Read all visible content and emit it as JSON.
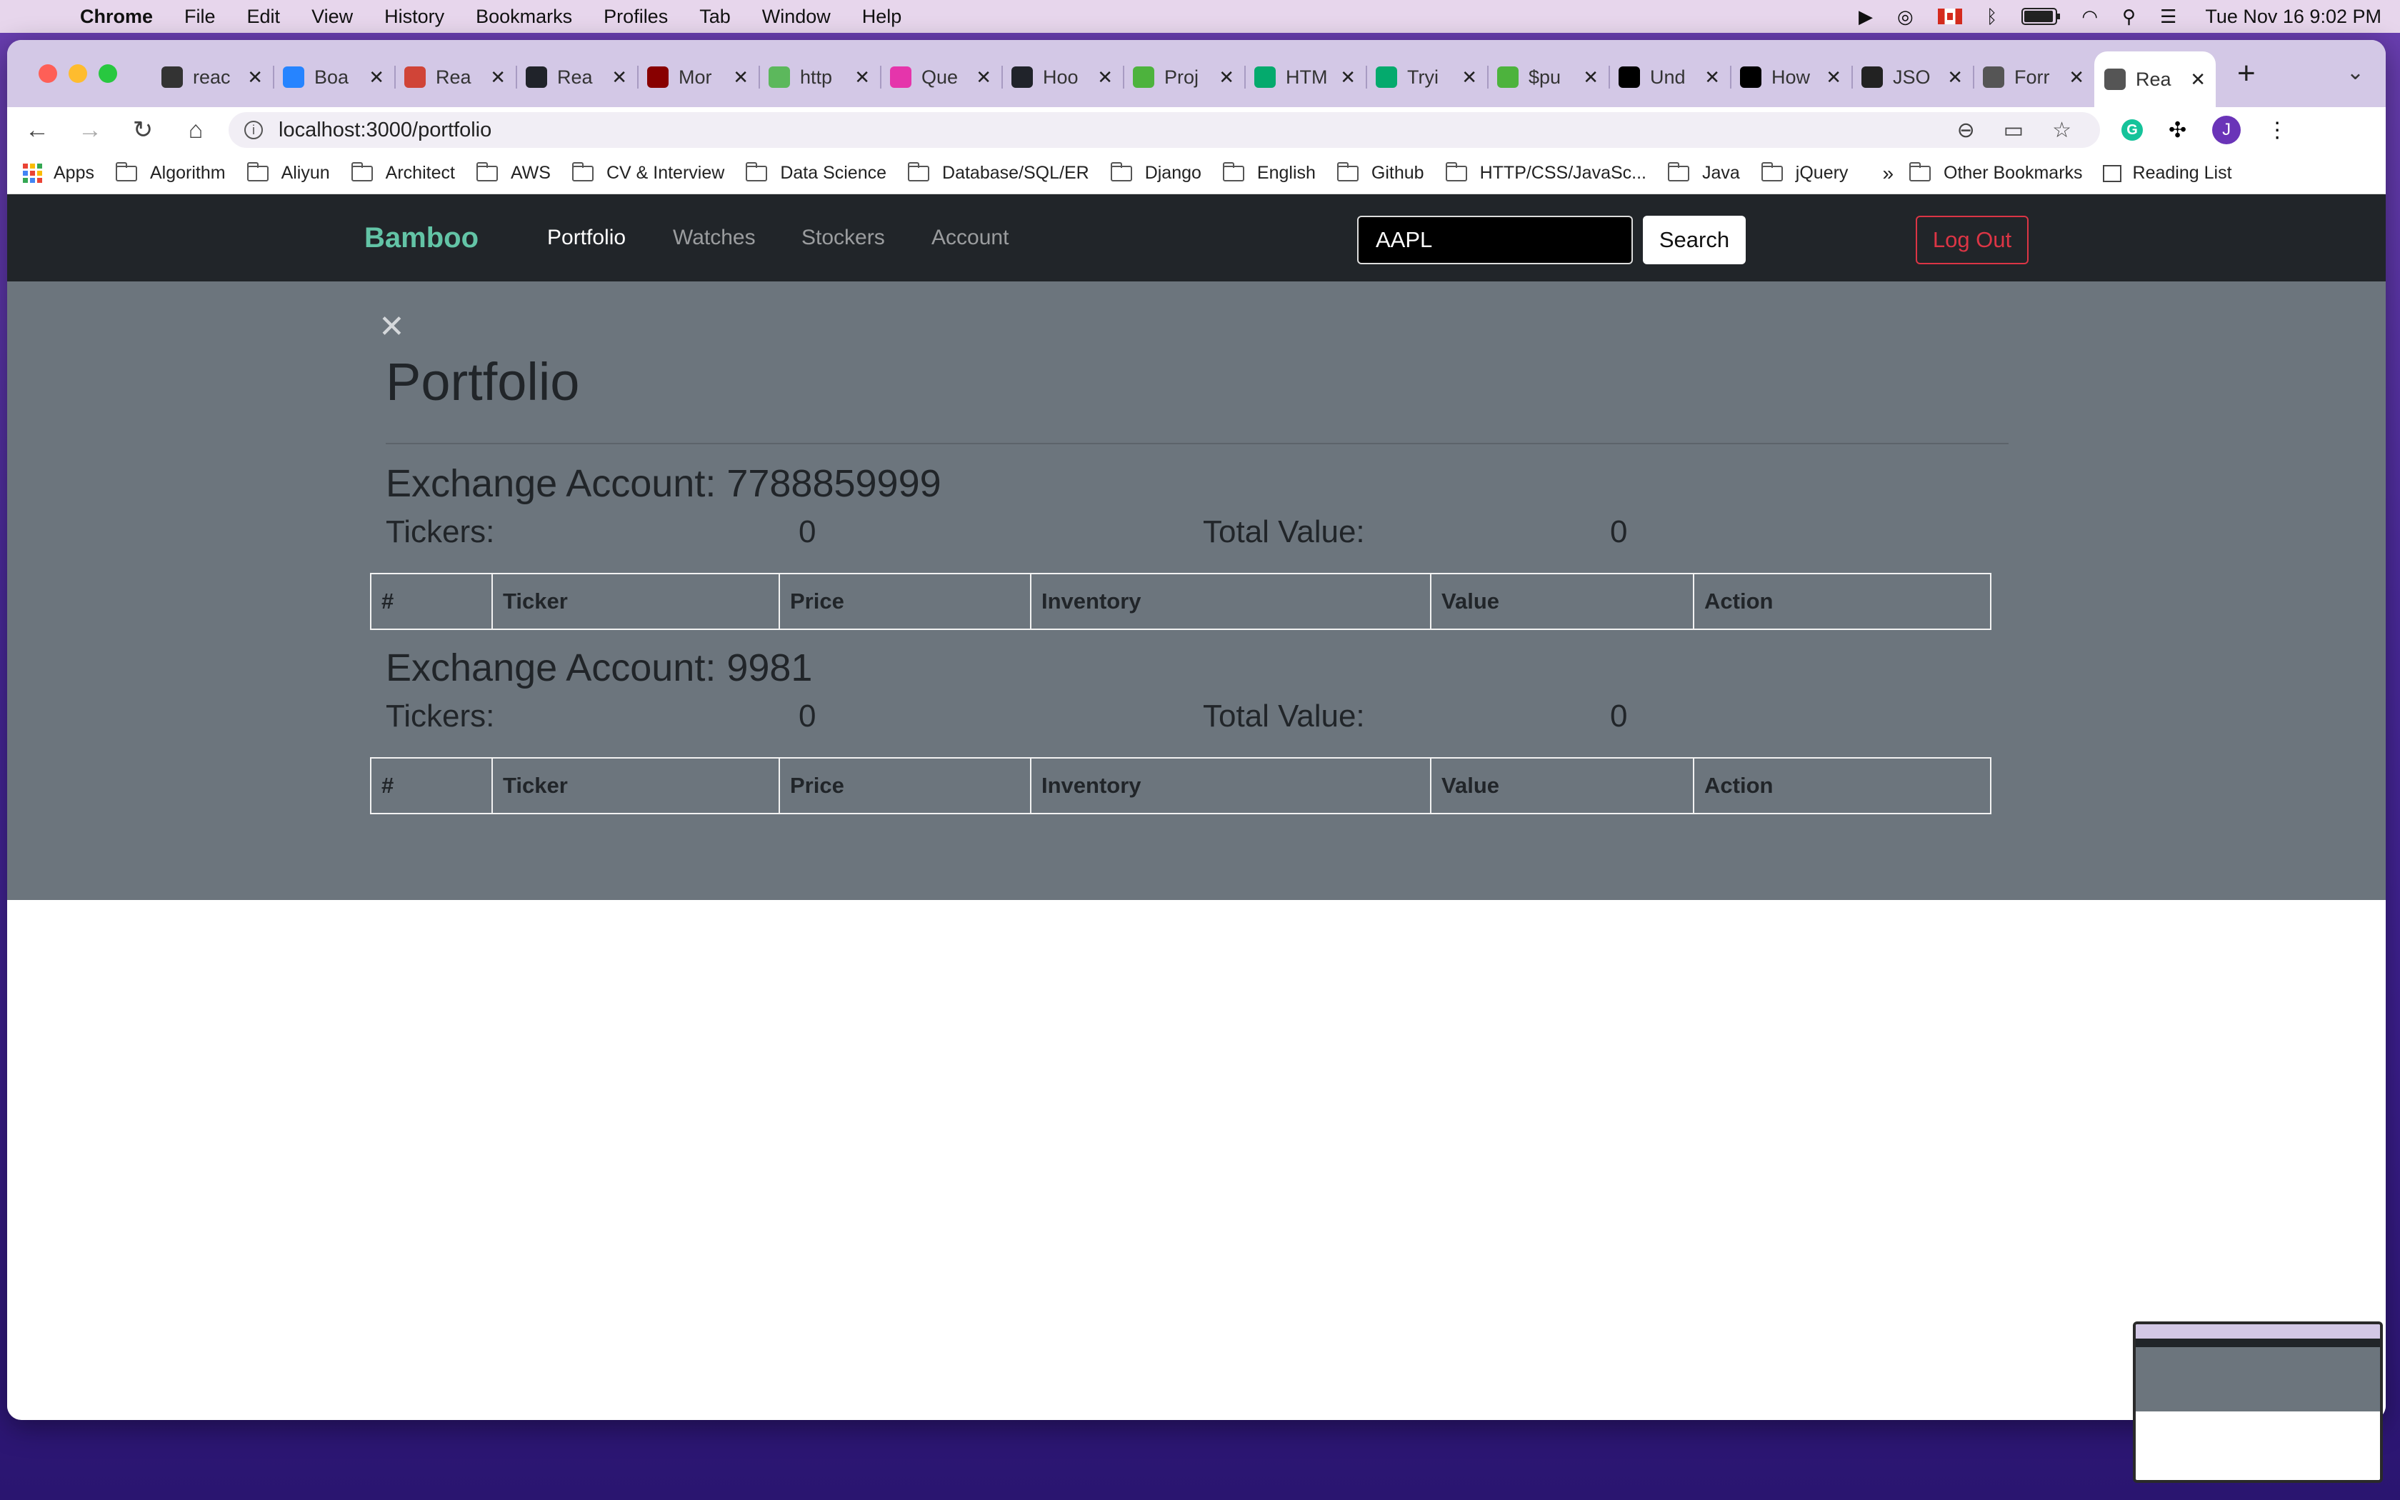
{
  "menubar": {
    "app_name": "Chrome",
    "items": [
      "File",
      "Edit",
      "View",
      "History",
      "Bookmarks",
      "Profiles",
      "Tab",
      "Window",
      "Help"
    ],
    "clock": "Tue Nov 16  9:02 PM"
  },
  "browser": {
    "tabs": [
      {
        "label": "reac",
        "icon": "github-icon",
        "color": "#333333"
      },
      {
        "label": "Boa",
        "icon": "jira-icon",
        "color": "#2684ff"
      },
      {
        "label": "Rea",
        "icon": "trello-icon",
        "color": "#d04437"
      },
      {
        "label": "Rea",
        "icon": "react-icon",
        "color": "#20232a"
      },
      {
        "label": "Mor",
        "icon": "mongoose-icon",
        "color": "#880000"
      },
      {
        "label": "http",
        "icon": "heart-icon",
        "color": "#5cb85c"
      },
      {
        "label": "Que",
        "icon": "graphql-icon",
        "color": "#e535ab"
      },
      {
        "label": "Hoo",
        "icon": "react-icon",
        "color": "#20232a"
      },
      {
        "label": "Proj",
        "icon": "leaf-icon",
        "color": "#4db33d"
      },
      {
        "label": "HTM",
        "icon": "w3-icon",
        "color": "#04aa6d"
      },
      {
        "label": "Tryi",
        "icon": "w3-icon",
        "color": "#04aa6d"
      },
      {
        "label": "$pu",
        "icon": "leaf-icon",
        "color": "#4db33d"
      },
      {
        "label": "Und",
        "icon": "medium-icon",
        "color": "#000000"
      },
      {
        "label": "How",
        "icon": "medium-icon",
        "color": "#000000"
      },
      {
        "label": "JSO",
        "icon": "json-icon",
        "color": "#222222"
      },
      {
        "label": "Forr",
        "icon": "globe-icon",
        "color": "#555555"
      },
      {
        "label": "Rea",
        "icon": "globe-icon",
        "color": "#555555",
        "active": true
      }
    ],
    "url": "localhost:3000/portfolio",
    "avatar_letter": "J",
    "ext_letter": "G",
    "bookmarks": [
      "Algorithm",
      "Aliyun",
      "Architect",
      "AWS",
      "CV & Interview",
      "Data Science",
      "Database/SQL/ER",
      "Django",
      "English",
      "Github",
      "HTTP/CSS/JavaSc...",
      "Java",
      "jQuery"
    ],
    "apps_label": "Apps",
    "more_label": "»",
    "other_bookmarks": "Other Bookmarks",
    "reading_list": "Reading List"
  },
  "app": {
    "brand": "Bamboo",
    "nav": [
      "Portfolio",
      "Watches",
      "Stockers",
      "Account"
    ],
    "search_value": "AAPL",
    "search_button": "Search",
    "logout_button": "Log Out",
    "close_symbol": "✕",
    "page_title": "Portfolio",
    "columns": [
      "#",
      "Ticker",
      "Price",
      "Inventory",
      "Value",
      "Action"
    ],
    "accounts": [
      {
        "title": "Exchange Account: 7788859999",
        "tickers_label": "Tickers:",
        "tickers": "0",
        "total_label": "Total Value:",
        "total": "0"
      },
      {
        "title": "Exchange Account: 9981",
        "tickers_label": "Tickers:",
        "tickers": "0",
        "total_label": "Total Value:",
        "total": "0"
      }
    ]
  },
  "colors": {
    "brand": "#63c4a6",
    "navbar": "#212529",
    "overlay": "#6c757d",
    "logout": "#dc3545"
  }
}
